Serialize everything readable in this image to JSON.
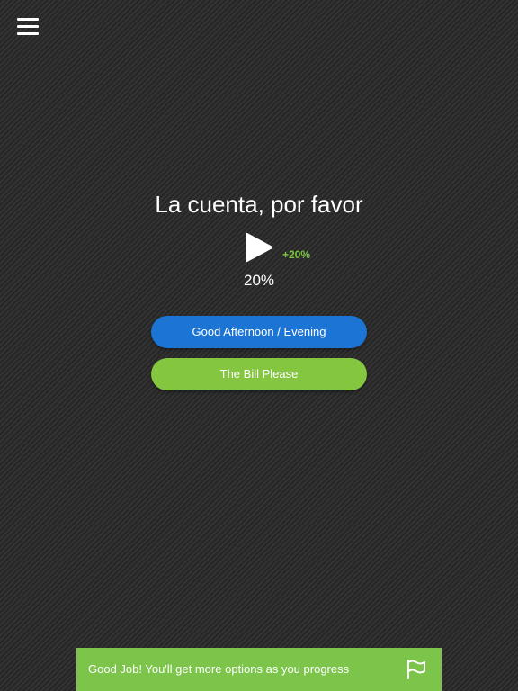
{
  "header": {
    "menu_icon": "hamburger-menu-icon"
  },
  "lesson": {
    "phrase": "La cuenta, por favor",
    "play_icon": "play-icon",
    "bonus": "+20%",
    "progress_text": "20%",
    "progress_value": 20
  },
  "answers": [
    {
      "label": "Good Afternoon / Evening",
      "color": "#1c74d4"
    },
    {
      "label": "The Bill Please",
      "color": "#84c63f"
    }
  ],
  "toast": {
    "message": "Good Job! You'll get more options as you progress",
    "flag_icon": "flag-icon",
    "color": "#7cc44a"
  },
  "colors": {
    "background": "#2b2b2b",
    "accent_green": "#7cc444",
    "accent_blue": "#1c74d4"
  }
}
